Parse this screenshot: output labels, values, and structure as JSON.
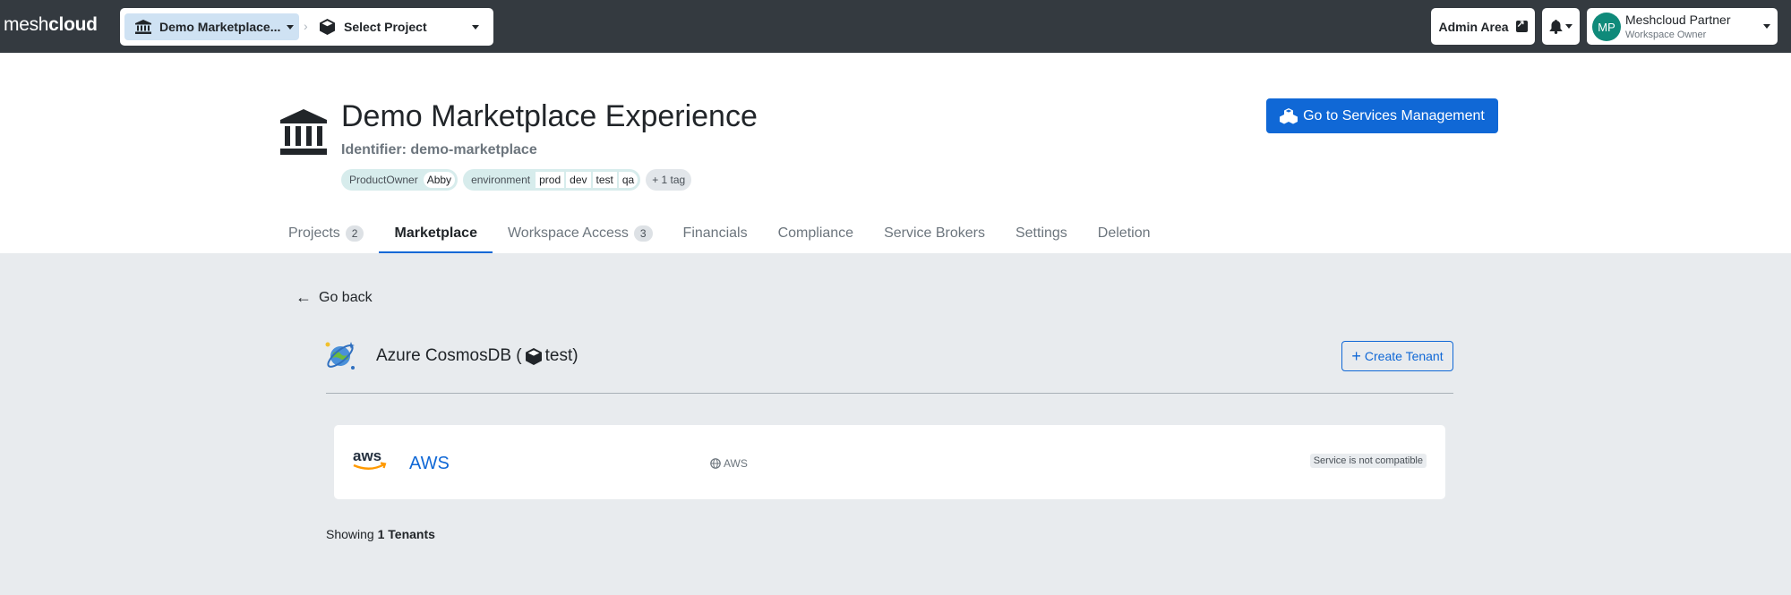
{
  "topbar": {
    "logo_light": "mesh",
    "logo_bold": "cloud",
    "workspace_selector": "Demo Marketplace...",
    "breadcrumb_separator": "›",
    "project_selector": "Select Project",
    "admin_area": "Admin Area",
    "user": {
      "initials": "MP",
      "name": "Meshcloud Partner",
      "role": "Workspace Owner"
    }
  },
  "header": {
    "title": "Demo Marketplace Experience",
    "identifier": "Identifier: demo-marketplace",
    "tags": [
      {
        "key": "ProductOwner",
        "values": [
          "Abby"
        ]
      },
      {
        "key": "environment",
        "values": [
          "prod",
          "dev",
          "test",
          "qa"
        ]
      }
    ],
    "more_tags": "+ 1 tag",
    "services_button": "Go to Services Management"
  },
  "tabs": [
    {
      "label": "Projects",
      "badge": "2"
    },
    {
      "label": "Marketplace",
      "badge": ""
    },
    {
      "label": "Workspace Access",
      "badge": "3"
    },
    {
      "label": "Financials",
      "badge": ""
    },
    {
      "label": "Compliance",
      "badge": ""
    },
    {
      "label": "Service Brokers",
      "badge": ""
    },
    {
      "label": "Settings",
      "badge": ""
    },
    {
      "label": "Deletion",
      "badge": ""
    }
  ],
  "active_tab": "Marketplace",
  "content": {
    "go_back": "Go back",
    "service_name": "Azure CosmosDB (",
    "service_project": "test)",
    "create_tenant": "Create Tenant",
    "tenant": {
      "logo_text": "aws",
      "name": "AWS",
      "platform": "AWS",
      "status": "Service is not compatible"
    },
    "showing_prefix": "Showing",
    "showing_count": "1 Tenants"
  },
  "colors": {
    "topbar": "#343a40",
    "primary": "#1068d6",
    "page_background": "#e8ebee",
    "tag_background": "#d7ecec",
    "avatar": "#0f8a7a"
  }
}
